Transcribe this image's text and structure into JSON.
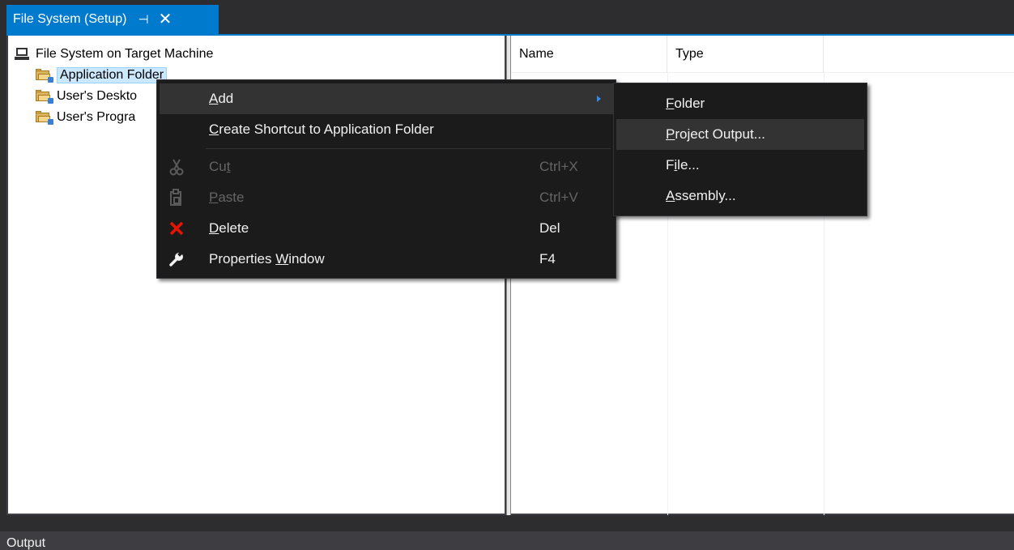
{
  "tab": {
    "title": "File System (Setup)",
    "pin_glyph": "⊣",
    "close_glyph": "✕"
  },
  "tree": {
    "root": "File System on Target Machine",
    "items": [
      {
        "label": "Application Folder"
      },
      {
        "label": "User's Deskto"
      },
      {
        "label": "User's Progra"
      }
    ]
  },
  "list": {
    "columns": [
      "Name",
      "Type"
    ]
  },
  "context_menu": {
    "items": [
      {
        "pre": "",
        "ul": "A",
        "post": "dd",
        "shortcut": "",
        "has_submenu": true
      },
      {
        "pre": "",
        "ul": "C",
        "post": "reate Shortcut to Application Folder",
        "shortcut": ""
      },
      {
        "pre": "Cu",
        "ul": "t",
        "post": "",
        "shortcut": "Ctrl+X",
        "disabled": true,
        "icon": "scissors-icon"
      },
      {
        "pre": "",
        "ul": "P",
        "post": "aste",
        "shortcut": "Ctrl+V",
        "disabled": true,
        "icon": "paste-icon"
      },
      {
        "pre": "",
        "ul": "D",
        "post": "elete",
        "shortcut": "Del",
        "icon": "delete-x-icon"
      },
      {
        "pre": "Properties ",
        "ul": "W",
        "post": "indow",
        "shortcut": "F4",
        "icon": "wrench-icon"
      }
    ]
  },
  "submenu": {
    "items": [
      {
        "pre": "",
        "ul": "F",
        "post": "older"
      },
      {
        "pre": "",
        "ul": "P",
        "post": "roject Output..."
      },
      {
        "pre": "F",
        "ul": "i",
        "post": "le..."
      },
      {
        "pre": "",
        "ul": "A",
        "post": "ssembly..."
      }
    ]
  },
  "output": {
    "label": "Output"
  },
  "colors": {
    "accent": "#007acc",
    "menu_bg": "#1b1b1c",
    "menu_hover": "#333334",
    "delete_red": "#e51400"
  }
}
